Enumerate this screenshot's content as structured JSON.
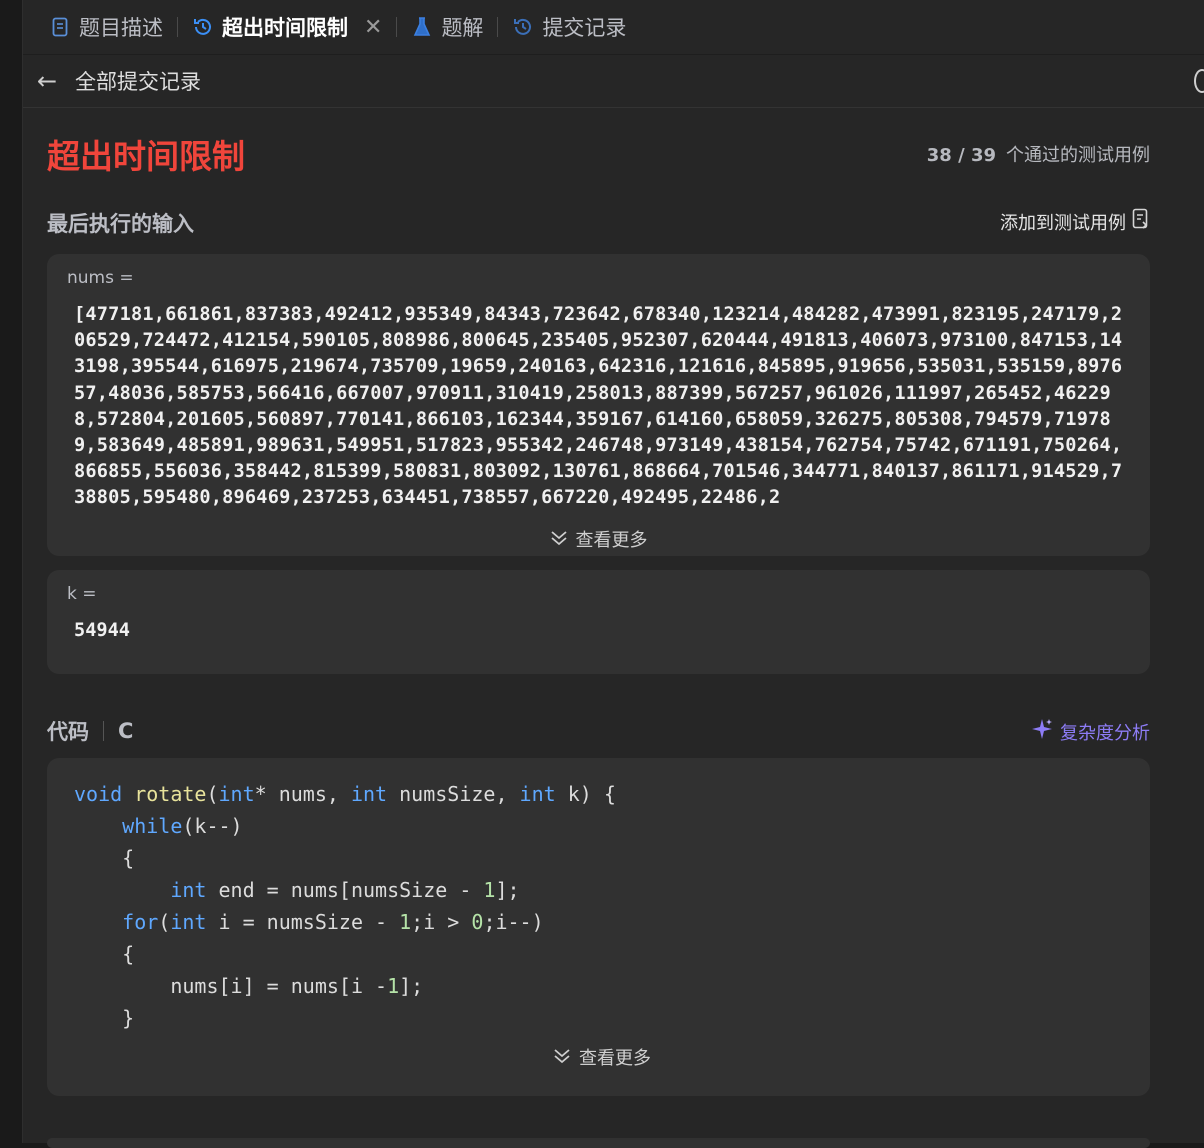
{
  "tabs": [
    {
      "label": "题目描述",
      "icon": "doc-icon"
    },
    {
      "label": "超出时间限制",
      "icon": "history-icon",
      "close": "✕"
    },
    {
      "label": "题解",
      "icon": "flask-icon"
    },
    {
      "label": "提交记录",
      "icon": "history-icon"
    }
  ],
  "subheader": {
    "back": "←",
    "title": "全部提交记录"
  },
  "result": {
    "status": "超出时间限制",
    "passed": "38 / 39",
    "passed_suffix": "个通过的测试用例"
  },
  "input_section": {
    "title": "最后执行的输入",
    "add_action": "添加到测试用例",
    "nums_label": "nums =",
    "nums_value": "[477181,661861,837383,492412,935349,84343,723642,678340,123214,484282,473991,823195,247179,206529,724472,412154,590105,808986,800645,235405,952307,620444,491813,406073,973100,847153,143198,395544,616975,219674,735709,19659,240163,642316,121616,845895,919656,535031,535159,897657,48036,585753,566416,667007,970911,310419,258013,887399,567257,961026,111997,265452,462298,572804,201605,560897,770141,866103,162344,359167,614160,658059,326275,805308,794579,719789,583649,485891,989631,549951,517823,955342,246748,973149,438154,762754,75742,671191,750264,866855,556036,358442,815399,580831,803092,130761,868664,701546,344771,840137,861171,914529,738805,595480,896469,237253,634451,738557,667220,492495,22486,2",
    "more": "查看更多",
    "k_label": "k =",
    "k_value": "54944"
  },
  "code_section": {
    "title": "代码",
    "lang": "C",
    "analysis": "复杂度分析",
    "more": "查看更多",
    "tokens": {
      "l1a": "void",
      "l1b": "rotate",
      "l1c": "(",
      "l1d": "int",
      "l1e": "* nums, ",
      "l1f": "int",
      "l1g": " numsSize, ",
      "l1h": "int",
      "l1i": " k) {",
      "l2a": "while",
      "l2b": "(k--)",
      "l3": "{",
      "l4a": "int",
      "l4b": " end = nums[numsSize - ",
      "l4c": "1",
      "l4d": "];",
      "l5a": "for",
      "l5b": "(",
      "l5c": "int",
      "l5d": " i = numsSize - ",
      "l5e": "1",
      "l5f": ";i > ",
      "l5g": "0",
      "l5h": ";i--)",
      "l6": "{",
      "l7a": "nums[i] = nums[i -",
      "l7b": "1",
      "l7c": "];",
      "l8": "}"
    }
  }
}
